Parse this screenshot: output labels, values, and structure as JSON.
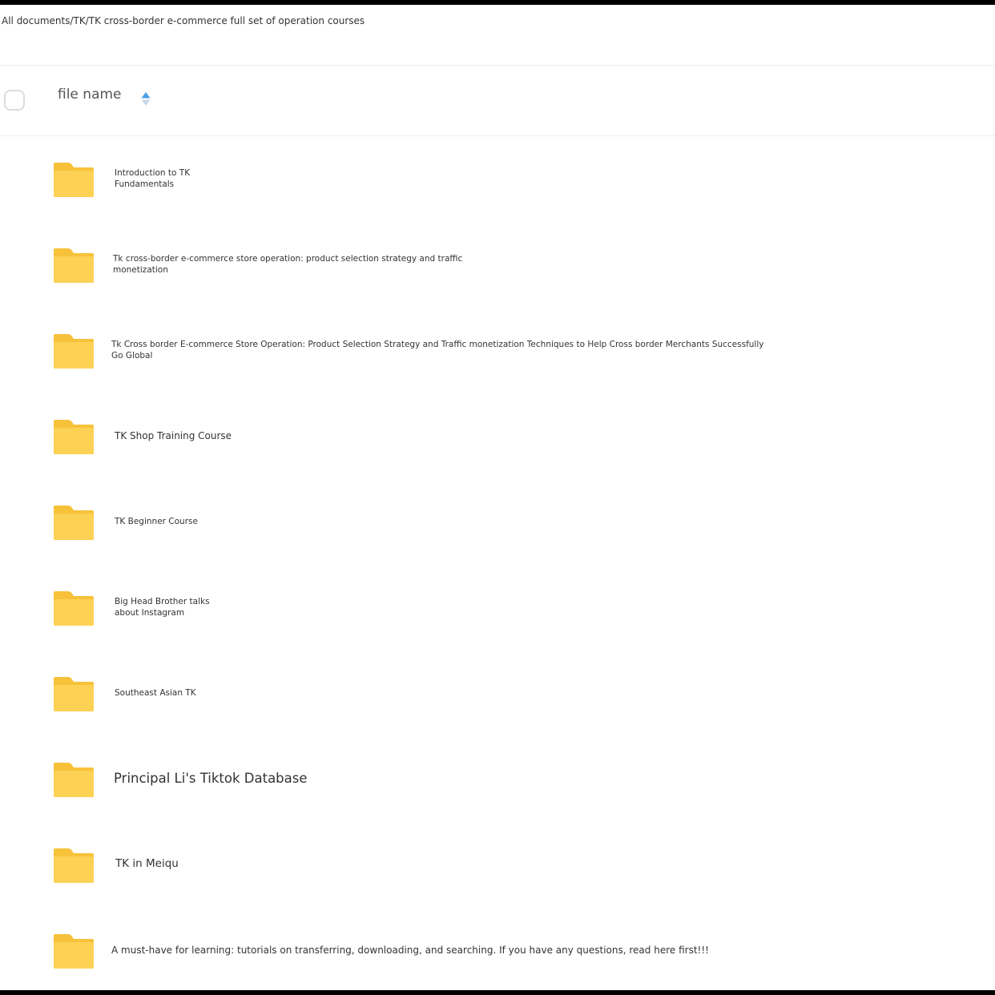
{
  "breadcrumb": "All documents/TK/TK cross-border e-commerce full set of operation courses",
  "header": {
    "file_name_label": "file name",
    "select_all_icon": "checkbox-icon",
    "sort_icon": "sort-arrows-icon",
    "sort_active_color": "#4a9fe8"
  },
  "folder_color": "#fcd154",
  "files": [
    {
      "name": "Introduction to TK Fundamentals",
      "icon": "folder-icon"
    },
    {
      "name": "Tk cross-border e-commerce store operation: product selection strategy and traffic monetization",
      "icon": "folder-icon"
    },
    {
      "name": "Tk Cross border E-commerce Store Operation: Product Selection Strategy and Traffic monetization Techniques to Help Cross border Merchants Successfully Go Global",
      "icon": "folder-icon"
    },
    {
      "name": "TK Shop Training Course",
      "icon": "folder-icon"
    },
    {
      "name": "TK Beginner Course",
      "icon": "folder-icon"
    },
    {
      "name": "Big Head Brother talks about Instagram",
      "icon": "folder-icon"
    },
    {
      "name": "Southeast Asian TK",
      "icon": "folder-icon"
    },
    {
      "name": "Principal Li's Tiktok Database",
      "icon": "folder-icon"
    },
    {
      "name": "TK in Meiqu",
      "icon": "folder-icon"
    },
    {
      "name": "A must-have for learning: tutorials on transferring, downloading, and searching. If you have any questions, read here first!!!",
      "icon": "folder-icon"
    }
  ]
}
